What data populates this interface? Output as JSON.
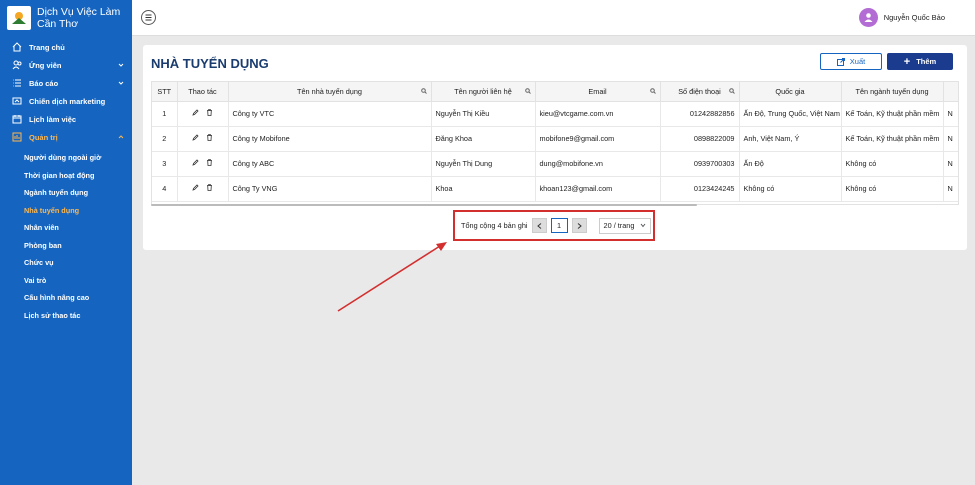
{
  "brand": {
    "line1": "Dịch Vụ Việc Làm",
    "line2": "Cần Thơ"
  },
  "nav": [
    {
      "label": "Trang chủ",
      "icon": "home-icon"
    },
    {
      "label": "Ứng viên",
      "icon": "users-icon",
      "chevron": "down"
    },
    {
      "label": "Báo cáo",
      "icon": "list-icon",
      "chevron": "down"
    },
    {
      "label": "Chiến dịch marketing",
      "icon": "campaign-icon"
    },
    {
      "label": "Lịch làm việc",
      "icon": "calendar-icon"
    },
    {
      "label": "Quản trị",
      "icon": "admin-icon",
      "chevron": "up",
      "active": true
    }
  ],
  "subnav": [
    "Người dùng ngoài giờ",
    "Thời gian hoạt động",
    "Ngành tuyển dụng",
    "Nhà tuyển dụng",
    "Nhân viên",
    "Phòng ban",
    "Chức vụ",
    "Vai trò",
    "Cấu hình nâng cao",
    "Lịch sử thao tác"
  ],
  "subnav_active": "Nhà tuyển dụng",
  "user": {
    "name": "Nguyễn Quốc Bảo"
  },
  "page": {
    "title": "NHÀ TUYỂN DỤNG",
    "export_label": "Xuất",
    "add_label": "Thêm"
  },
  "table": {
    "headers": [
      "STT",
      "Thao tác",
      "Tên nhà tuyển dụng",
      "Tên người liên hệ",
      "Email",
      "Số điện thoại",
      "Quốc gia",
      "Tên ngành tuyển dụng",
      ""
    ],
    "rows": [
      [
        "1",
        "Công ty VTC",
        "Nguyễn Thị Kiều",
        "kieu@vtcgame.com.vn",
        "01242882856",
        "Ấn Độ, Trung Quốc, Việt Nam",
        "Kế Toán, Kỹ thuật phần mềm",
        "N"
      ],
      [
        "2",
        "Công ty Mobifone",
        "Đăng Khoa",
        "mobifone9@gmail.com",
        "0898822009",
        "Anh, Việt Nam, Ý",
        "Kế Toán, Kỹ thuật phần mềm",
        "N"
      ],
      [
        "3",
        "Công ty ABC",
        "Nguyễn Thị Dung",
        "dung@mobifone.vn",
        "0939700303",
        "Ấn Độ",
        "Không có",
        "N"
      ],
      [
        "4",
        "Công Ty VNG",
        "Khoa",
        "khoan123@gmail.com",
        "0123424245",
        "Không có",
        "Không có",
        "N"
      ]
    ]
  },
  "pagination": {
    "total_label": "Tổng cộng 4 bản ghi",
    "current_page": "1",
    "page_size": "20 / trang"
  },
  "colors": {
    "sidebar": "#1565c0",
    "active": "#ffb74d",
    "highlight": "#d32f2f"
  }
}
